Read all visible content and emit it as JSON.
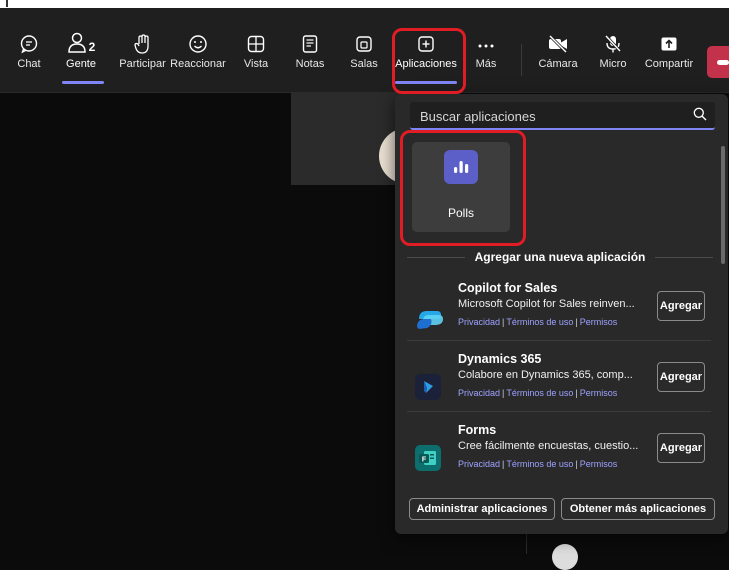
{
  "toolbar": {
    "chat": {
      "label": "Chat",
      "icon": "chat-icon"
    },
    "people": {
      "label": "Gente",
      "count": "2",
      "icon": "people-icon"
    },
    "raise": {
      "label": "Participar",
      "icon": "raise-hand-icon"
    },
    "react": {
      "label": "Reaccionar",
      "icon": "smile-icon"
    },
    "view": {
      "label": "Vista",
      "icon": "grid-icon"
    },
    "notes": {
      "label": "Notas",
      "icon": "notes-icon"
    },
    "rooms": {
      "label": "Salas",
      "icon": "rooms-icon"
    },
    "apps": {
      "label": "Aplicaciones",
      "icon": "apps-icon"
    },
    "more": {
      "label": "Más",
      "icon": "more-icon"
    },
    "camera": {
      "label": "Cámara",
      "icon": "camera-off-icon"
    },
    "mic": {
      "label": "Micro",
      "icon": "mic-off-icon"
    },
    "share": {
      "label": "Compartir",
      "icon": "share-icon"
    }
  },
  "apps_popup": {
    "search_placeholder": "Buscar aplicaciones",
    "installed": [
      {
        "name": "Polls",
        "icon": "polls-icon"
      }
    ],
    "section_title": "Agregar una nueva aplicación",
    "suggestions": [
      {
        "name": "Copilot for Sales",
        "description": "Microsoft Copilot for Sales reinven...",
        "privacy": "Privacidad",
        "terms": "Términos de uso",
        "permissions": "Permisos",
        "add": "Agregar",
        "icon": "copilot-icon"
      },
      {
        "name": "Dynamics 365",
        "description": "Colabore en Dynamics 365, comp...",
        "privacy": "Privacidad",
        "terms": "Términos de uso",
        "permissions": "Permisos",
        "add": "Agregar",
        "icon": "dynamics-icon"
      },
      {
        "name": "Forms",
        "description": "Cree fácilmente encuestas, cuestio...",
        "privacy": "Privacidad",
        "terms": "Términos de uso",
        "permissions": "Permisos",
        "add": "Agregar",
        "icon": "forms-icon"
      }
    ],
    "manage_label": "Administrar aplicaciones",
    "more_label": "Obtener más aplicaciones"
  },
  "colors": {
    "accent": "#7f85f5",
    "highlight": "#e01c24",
    "leave": "#c4314b",
    "polls": "#5b5fc7"
  }
}
